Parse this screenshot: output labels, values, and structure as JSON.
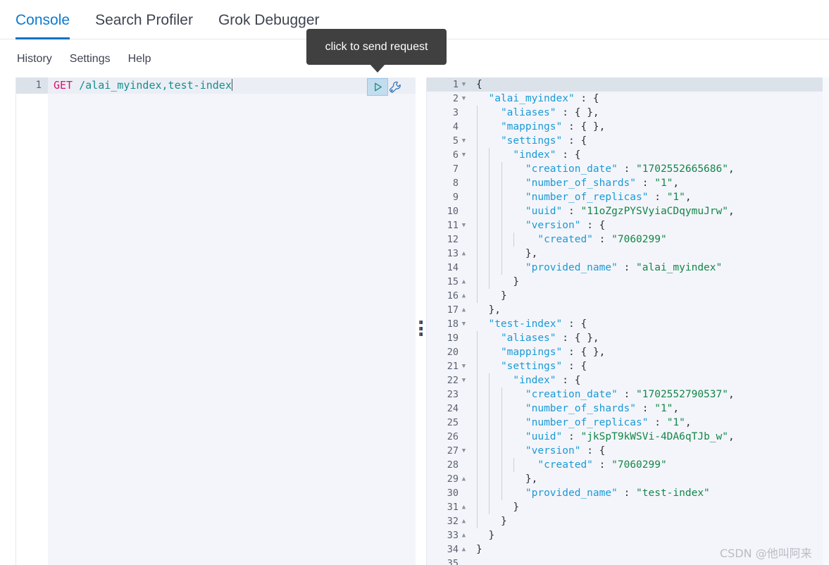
{
  "app": {
    "tabs": [
      {
        "label": "Console",
        "active": true
      },
      {
        "label": "Search Profiler",
        "active": false
      },
      {
        "label": "Grok Debugger",
        "active": false
      }
    ],
    "menu": [
      {
        "label": "History"
      },
      {
        "label": "Settings"
      },
      {
        "label": "Help"
      }
    ]
  },
  "tooltip": {
    "text": "click to send request"
  },
  "request": {
    "line_number": "1",
    "method": "GET",
    "path": "/alai_myindex,test-index",
    "run_icon": "play-icon",
    "wrench_icon": "wrench-icon"
  },
  "response": {
    "lines": [
      {
        "n": "1",
        "fold": "open",
        "guides": 0,
        "text": "{"
      },
      {
        "n": "2",
        "fold": "open",
        "guides": 0,
        "text": "  \"alai_myindex\" : {",
        "key": "\"alai_myindex\""
      },
      {
        "n": "3",
        "fold": "",
        "guides": 1,
        "text": "    \"aliases\" : { },"
      },
      {
        "n": "4",
        "fold": "",
        "guides": 1,
        "text": "    \"mappings\" : { },"
      },
      {
        "n": "5",
        "fold": "open",
        "guides": 1,
        "text": "    \"settings\" : {"
      },
      {
        "n": "6",
        "fold": "open",
        "guides": 2,
        "text": "      \"index\" : {"
      },
      {
        "n": "7",
        "fold": "",
        "guides": 3,
        "text": "        \"creation_date\" : \"1702552665686\","
      },
      {
        "n": "8",
        "fold": "",
        "guides": 3,
        "text": "        \"number_of_shards\" : \"1\","
      },
      {
        "n": "9",
        "fold": "",
        "guides": 3,
        "text": "        \"number_of_replicas\" : \"1\","
      },
      {
        "n": "10",
        "fold": "",
        "guides": 3,
        "text": "        \"uuid\" : \"11oZgzPYSVyiaCDqymuJrw\","
      },
      {
        "n": "11",
        "fold": "open",
        "guides": 3,
        "text": "        \"version\" : {"
      },
      {
        "n": "12",
        "fold": "",
        "guides": 4,
        "text": "          \"created\" : \"7060299\""
      },
      {
        "n": "13",
        "fold": "close",
        "guides": 3,
        "text": "        },"
      },
      {
        "n": "14",
        "fold": "",
        "guides": 3,
        "text": "        \"provided_name\" : \"alai_myindex\""
      },
      {
        "n": "15",
        "fold": "close",
        "guides": 2,
        "text": "      }"
      },
      {
        "n": "16",
        "fold": "close",
        "guides": 1,
        "text": "    }"
      },
      {
        "n": "17",
        "fold": "close",
        "guides": 0,
        "text": "  },"
      },
      {
        "n": "18",
        "fold": "open",
        "guides": 0,
        "text": "  \"test-index\" : {",
        "key": "\"test-index\""
      },
      {
        "n": "19",
        "fold": "",
        "guides": 1,
        "text": "    \"aliases\" : { },"
      },
      {
        "n": "20",
        "fold": "",
        "guides": 1,
        "text": "    \"mappings\" : { },"
      },
      {
        "n": "21",
        "fold": "open",
        "guides": 1,
        "text": "    \"settings\" : {"
      },
      {
        "n": "22",
        "fold": "open",
        "guides": 2,
        "text": "      \"index\" : {"
      },
      {
        "n": "23",
        "fold": "",
        "guides": 3,
        "text": "        \"creation_date\" : \"1702552790537\","
      },
      {
        "n": "24",
        "fold": "",
        "guides": 3,
        "text": "        \"number_of_shards\" : \"1\","
      },
      {
        "n": "25",
        "fold": "",
        "guides": 3,
        "text": "        \"number_of_replicas\" : \"1\","
      },
      {
        "n": "26",
        "fold": "",
        "guides": 3,
        "text": "        \"uuid\" : \"jkSpT9kWSVi-4DA6qTJb_w\","
      },
      {
        "n": "27",
        "fold": "open",
        "guides": 3,
        "text": "        \"version\" : {"
      },
      {
        "n": "28",
        "fold": "",
        "guides": 4,
        "text": "          \"created\" : \"7060299\""
      },
      {
        "n": "29",
        "fold": "close",
        "guides": 3,
        "text": "        },"
      },
      {
        "n": "30",
        "fold": "",
        "guides": 3,
        "text": "        \"provided_name\" : \"test-index\""
      },
      {
        "n": "31",
        "fold": "close",
        "guides": 2,
        "text": "      }"
      },
      {
        "n": "32",
        "fold": "close",
        "guides": 1,
        "text": "    }"
      },
      {
        "n": "33",
        "fold": "close",
        "guides": 0,
        "text": "  }"
      },
      {
        "n": "34",
        "fold": "close",
        "guides": 0,
        "text": "}"
      },
      {
        "n": "35",
        "fold": "",
        "guides": 0,
        "text": ""
      }
    ]
  },
  "watermark": {
    "text": "CSDN @他叫阿来"
  },
  "colors": {
    "accent": "#0b7ad1",
    "method": "#d5136f",
    "path": "#128f8f",
    "json_key": "#1a9ad6",
    "json_string": "#13864a",
    "tooltip_bg": "#404040",
    "active_row": "#dce2ea"
  }
}
